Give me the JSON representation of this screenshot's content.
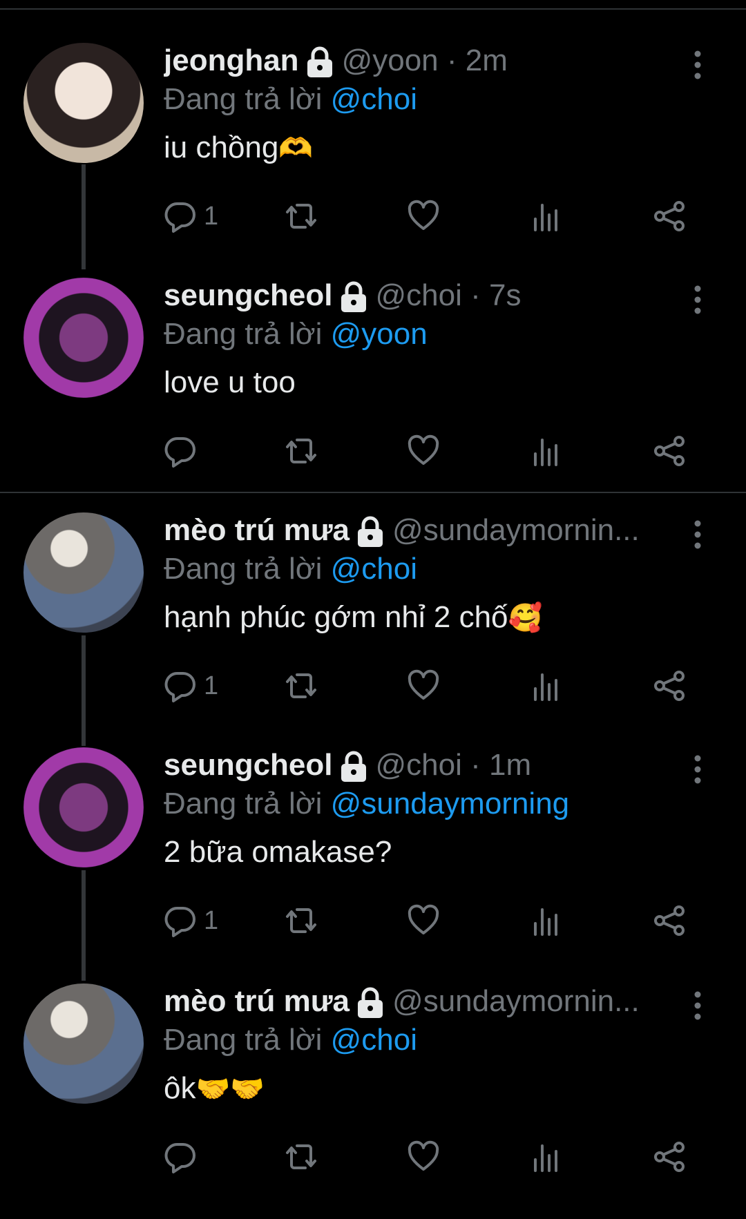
{
  "tweets": [
    {
      "name": "jeonghan",
      "handle": "@yoon",
      "time": "2m",
      "reply_prefix": "Đang trả lời",
      "reply_to": "@choi",
      "text": "iu chồng",
      "emoji": "🫶",
      "reply_count": "1"
    },
    {
      "name": "seungcheol",
      "handle": "@choi",
      "time": "7s",
      "reply_prefix": "Đang trả lời",
      "reply_to": "@yoon",
      "text": "love u too",
      "emoji": "",
      "reply_count": ""
    },
    {
      "name": "mèo trú mưa",
      "handle": "@sundaymornin...",
      "time": "",
      "reply_prefix": "Đang trả lời",
      "reply_to": "@choi",
      "text": "hạnh phúc gớm nhỉ 2 chố",
      "emoji": "🥰",
      "reply_count": "1"
    },
    {
      "name": "seungcheol",
      "handle": "@choi",
      "time": "1m",
      "reply_prefix": "Đang trả lời",
      "reply_to": "@sundaymorning",
      "text": "2 bữa omakase?",
      "emoji": "",
      "reply_count": "1"
    },
    {
      "name": "mèo trú mưa",
      "handle": "@sundaymornin...",
      "time": "",
      "reply_prefix": "Đang trả lời",
      "reply_to": "@choi",
      "text": "ôk",
      "emoji": "🤝🤝",
      "reply_count": ""
    }
  ],
  "icons": {
    "reply": "reply-icon",
    "retweet": "retweet-icon",
    "like": "heart-icon",
    "views": "views-icon",
    "share": "share-icon",
    "more": "more-vertical-icon",
    "lock": "lock-icon"
  },
  "colors": {
    "background": "#000000",
    "primary_text": "#e7e9ea",
    "secondary_text": "#71767b",
    "mention": "#1d9bf0",
    "divider": "#2f3336"
  }
}
